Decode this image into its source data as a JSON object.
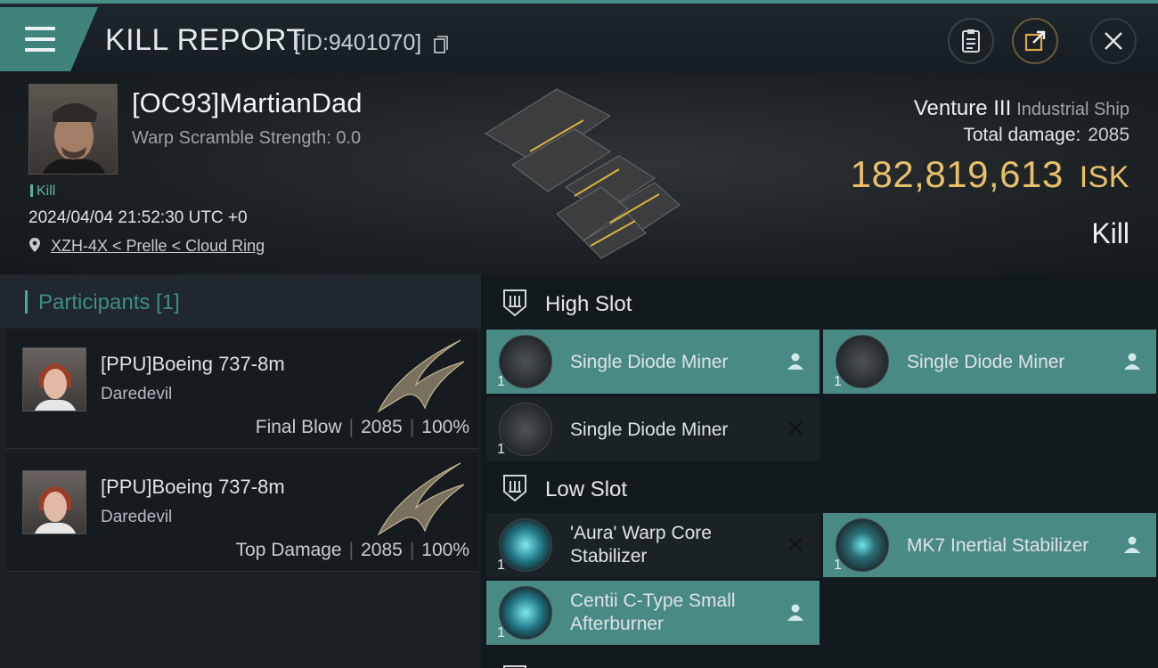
{
  "header": {
    "title": "KILL REPORT",
    "report_id": "[ID:9401070]",
    "buttons": [
      {
        "name": "clipboard-icon"
      },
      {
        "name": "share-icon"
      },
      {
        "name": "close-icon"
      }
    ]
  },
  "victim": {
    "name": "[OC93]MartianDad",
    "warp_scramble": "Warp Scramble Strength: 0.0",
    "tag": "Kill",
    "datetime": "2024/04/04 21:52:30 UTC +0",
    "location": "XZH-4X < Prelle < Cloud Ring",
    "ship_name": "Venture III",
    "ship_class": "Industrial Ship",
    "total_damage_label": "Total damage:",
    "total_damage": "2085",
    "isk_value": "182,819,613",
    "isk_unit": "ISK",
    "result": "Kill"
  },
  "participants": {
    "title": "Participants [1]",
    "rows": [
      {
        "name": "[PPU]Boeing 737-8m",
        "ship": "Daredevil",
        "role": "Final Blow",
        "damage": "2085",
        "percent": "100%"
      },
      {
        "name": "[PPU]Boeing 737-8m",
        "ship": "Daredevil",
        "role": "Top Damage",
        "damage": "2085",
        "percent": "100%"
      }
    ]
  },
  "fitting": {
    "high_slot": {
      "label": "High Slot",
      "modules": [
        {
          "name": "Single Diode Miner",
          "qty": "1",
          "status": "dropped"
        },
        {
          "name": "Single Diode Miner",
          "qty": "1",
          "status": "dropped"
        },
        {
          "name": "Single Diode Miner",
          "qty": "1",
          "status": "destroyed"
        }
      ]
    },
    "low_slot": {
      "label": "Low Slot",
      "modules": [
        {
          "name": "'Aura' Warp Core Stabilizer",
          "qty": "1",
          "status": "destroyed"
        },
        {
          "name": "MK7 Inertial Stabilizer",
          "qty": "1",
          "status": "dropped"
        },
        {
          "name": "Centii C-Type Small Afterburner",
          "qty": "1",
          "status": "dropped"
        }
      ]
    }
  },
  "colors": {
    "accent_teal": "#4a8a84",
    "isk_gold": "#e9c06a",
    "background": "#131a1e"
  }
}
